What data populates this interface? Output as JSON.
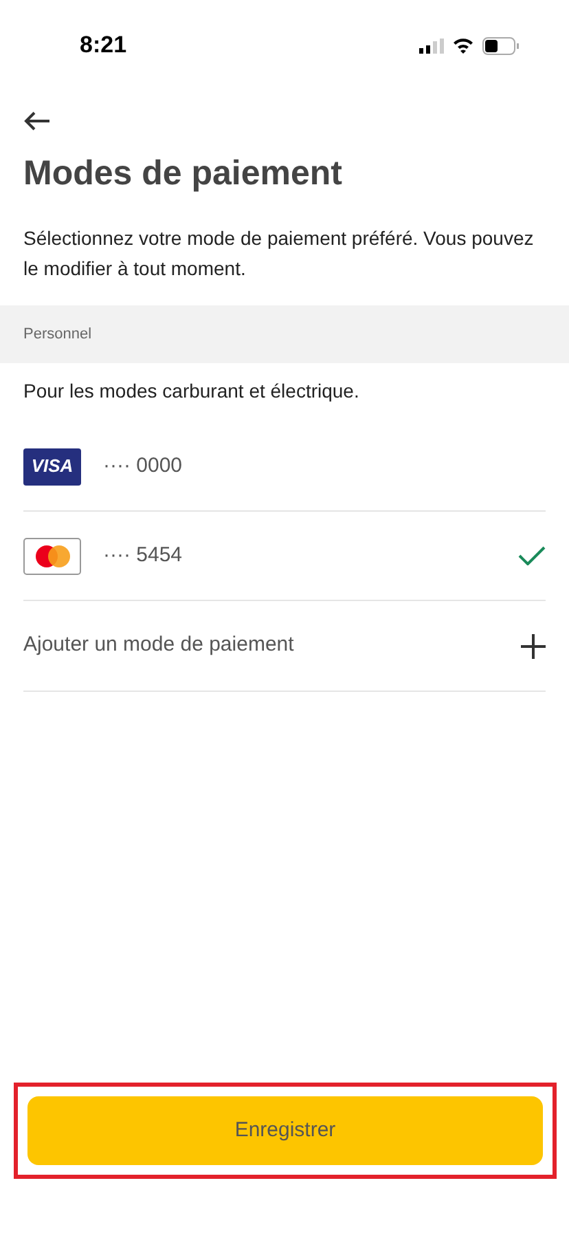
{
  "status_bar": {
    "time": "8:21"
  },
  "title": "Modes de paiement",
  "description": "Sélectionnez votre mode de paiement préféré. Vous pouvez le modifier à tout moment.",
  "section": {
    "label": "Personnel",
    "subtitle": "Pour les modes carburant et électrique."
  },
  "cards": [
    {
      "kind": "visa",
      "logo_text": "VISA",
      "number": "···· 0000",
      "selected": false
    },
    {
      "kind": "mastercard",
      "number": "···· 5454",
      "selected": true
    }
  ],
  "add_label": "Ajouter un mode de paiement",
  "save_button": {
    "label": "Enregistrer",
    "highlighted": true
  }
}
